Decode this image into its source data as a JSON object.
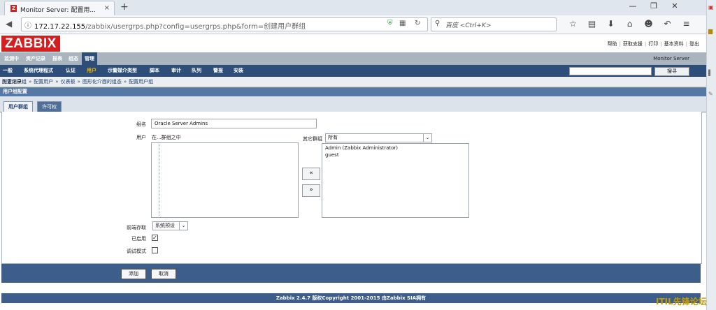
{
  "browser": {
    "tab_title": "Monitor Server: 配置用...",
    "tab_close": "×",
    "new_tab": "+",
    "url_host": "172.17.22.155",
    "url_rest": "/zabbix/usergrps.php?config=usergrps.php&form=创建用户群组",
    "search_placeholder": "百度 <Ctrl+K>",
    "window_controls": [
      "—",
      "❐",
      "✕"
    ],
    "toolbar_icons": [
      "star-icon",
      "reading-list-icon",
      "download-icon",
      "home-icon",
      "smiley-icon",
      "undo-icon",
      "menu-icon"
    ]
  },
  "header": {
    "logo": "ZABBIX",
    "links": [
      "帮助",
      "获取支援",
      "打印",
      "基本资料",
      "登出"
    ],
    "server_name": "Monitor Server"
  },
  "main_menu": [
    "监测中",
    "资产记录",
    "报表",
    "组态",
    "管理"
  ],
  "sub_menu": [
    "一般",
    "系统代理程式",
    "认证",
    "用户",
    "示警媒介类型",
    "脚本",
    "审计",
    "队列",
    "警报",
    "安装"
  ],
  "search_button": "搜寻",
  "breadcrumb": {
    "label": "历史记录:",
    "items": [
      "配置用户组",
      "配置用户",
      "仪表板",
      "图形化介面的组态",
      "配置用户组"
    ]
  },
  "section_title": "用户组配置",
  "tabs": [
    "用户群组",
    "许可权"
  ],
  "form": {
    "group_name_label": "组名",
    "group_name_value": "Oracle Server Admins",
    "users_label": "用户",
    "in_group_label": "在...群组之中",
    "other_groups_label": "其它群组",
    "other_groups_value": "所有",
    "other_users": [
      "Admin (Zabbix Administrator)",
      "guest"
    ],
    "move_left": "«",
    "move_right": "»",
    "frontend_access_label": "前端存取",
    "frontend_access_value": "系统预设",
    "enabled_label": "已启用",
    "enabled_checked": true,
    "debug_label": "调试模式",
    "debug_checked": false
  },
  "buttons": {
    "add": "添加",
    "cancel": "取消"
  },
  "copyright": "Zabbix 2.4.7 版权Copyright 2001-2015 由Zabbix SIA拥有",
  "watermark": "ITIL先锋论坛",
  "colors": {
    "logo_red": "#d31f1f",
    "nav_blue": "#2d4e78",
    "active_submenu": "#f2b800"
  }
}
